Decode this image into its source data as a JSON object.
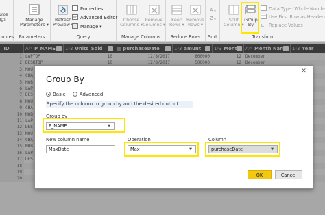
{
  "ribbon": {
    "source": {
      "line1": "ource",
      "line2": "ngs",
      "group_label": "Sources"
    },
    "manage_params": {
      "line1": "Manage",
      "line2": "Parameters",
      "group_label": "Parameters"
    },
    "query": {
      "refresh_line1": "Refresh",
      "refresh_line2": "Preview",
      "properties": "Properties",
      "advanced_editor": "Advanced Editor",
      "manage": "Manage",
      "group_label": "Query"
    },
    "manage_columns": {
      "choose_line1": "Choose",
      "choose_line2": "Columns",
      "remove_line1": "Remove",
      "remove_line2": "Columns",
      "group_label": "Manage Columns"
    },
    "reduce_rows": {
      "keep_line1": "Keep",
      "keep_line2": "Rows",
      "remove_line1": "Remove",
      "remove_line2": "Rows",
      "group_label": "Reduce Rows"
    },
    "sort": {
      "group_label": "Sort"
    },
    "transform": {
      "split_line1": "Split",
      "split_line2": "Column",
      "groupby_line1": "Group",
      "groupby_line2": "By",
      "data_type": "Data Type: Whole Number",
      "first_row": "Use First Row as Headers",
      "replace_values": "Replace Values",
      "group_label": "Transform"
    }
  },
  "grid": {
    "headers": {
      "id": "_ID",
      "p_name_type": "Aᴮᶜ",
      "p_name": "P_NAME",
      "units_type": "1²3",
      "units": "Units_Sold",
      "purchase": "purchaseDate",
      "amount_type": "1²3",
      "amount": "amunt",
      "month_type": "1²3",
      "month": "Month",
      "month_name_type": "Aᴮᶜ",
      "month_name": "Month Name",
      "year_type": "1²3",
      "year": "Year"
    },
    "rows": [
      {
        "idx": "1",
        "name": "LAPTOP",
        "units": "10",
        "date": "12/8/2017",
        "amount": "800000",
        "month": "12",
        "month_name": "December"
      },
      {
        "idx": "2",
        "name": "DESKTOP",
        "units": "10",
        "date": "12/8/2017",
        "amount": "500000",
        "month": "12",
        "month_name": "December"
      },
      {
        "idx": "3",
        "name": "MOU",
        "units": "",
        "date": "",
        "amount": "",
        "month": "",
        "month_name": ""
      },
      {
        "idx": "4",
        "name": "CHA",
        "units": "",
        "date": "",
        "amount": "",
        "month": "",
        "month_name": ""
      },
      {
        "idx": "5",
        "name": "MOB",
        "units": "",
        "date": "",
        "amount": "",
        "month": "",
        "month_name": ""
      },
      {
        "idx": "6",
        "name": "LAP",
        "units": "",
        "date": "",
        "amount": "",
        "month": "",
        "month_name": ""
      },
      {
        "idx": "7",
        "name": "DES",
        "units": "",
        "date": "",
        "amount": "",
        "month": "",
        "month_name": ""
      },
      {
        "idx": "8",
        "name": "MOU",
        "units": "",
        "date": "",
        "amount": "",
        "month": "",
        "month_name": ""
      },
      {
        "idx": "9",
        "name": "CHA",
        "units": "",
        "date": "",
        "amount": "",
        "month": "",
        "month_name": ""
      },
      {
        "idx": "10",
        "name": "MOB",
        "units": "",
        "date": "",
        "amount": "",
        "month": "",
        "month_name": ""
      },
      {
        "idx": "11",
        "name": "LAP",
        "units": "",
        "date": "",
        "amount": "",
        "month": "",
        "month_name": ""
      },
      {
        "idx": "12",
        "name": "DES",
        "units": "",
        "date": "",
        "amount": "",
        "month": "",
        "month_name": ""
      },
      {
        "idx": "13",
        "name": "MOU",
        "units": "",
        "date": "",
        "amount": "",
        "month": "",
        "month_name": ""
      },
      {
        "idx": "14",
        "name": "CHA",
        "units": "",
        "date": "",
        "amount": "",
        "month": "",
        "month_name": ""
      },
      {
        "idx": "15",
        "name": "MOB",
        "units": "",
        "date": "",
        "amount": "",
        "month": "",
        "month_name": ""
      },
      {
        "idx": "16",
        "name": "LAP",
        "units": "",
        "date": "",
        "amount": "",
        "month": "",
        "month_name": ""
      },
      {
        "idx": "17",
        "name": "DES",
        "units": "",
        "date": "",
        "amount": "",
        "month": "",
        "month_name": ""
      },
      {
        "idx": "18",
        "name": "",
        "units": "",
        "date": "",
        "amount": "",
        "month": "",
        "month_name": ""
      },
      {
        "idx": "19",
        "name": "",
        "units": "",
        "date": "",
        "amount": "",
        "month": "",
        "month_name": ""
      },
      {
        "idx": "20",
        "name": "",
        "units": "",
        "date": "",
        "amount": "",
        "month": "",
        "month_name": ""
      }
    ]
  },
  "dialog": {
    "title": "Group By",
    "close_glyph": "✕",
    "basic_label": "Basic",
    "advanced_label": "Advanced",
    "description": "Specify the column to group by and the desired output.",
    "group_by_label": "Group by",
    "group_by_value": "P_NAME",
    "new_column_label": "New column name",
    "new_column_value": "MaxDate",
    "operation_label": "Operation",
    "operation_value": "Max",
    "column_label": "Column",
    "column_value": "purchaseDate",
    "dropdown_glyph": "▼",
    "ok_label": "OK",
    "cancel_label": "Cancel"
  },
  "colors": {
    "highlight": "#ffe600",
    "ok_button": "#f2c811",
    "grid_header": "#3a3a3a"
  }
}
